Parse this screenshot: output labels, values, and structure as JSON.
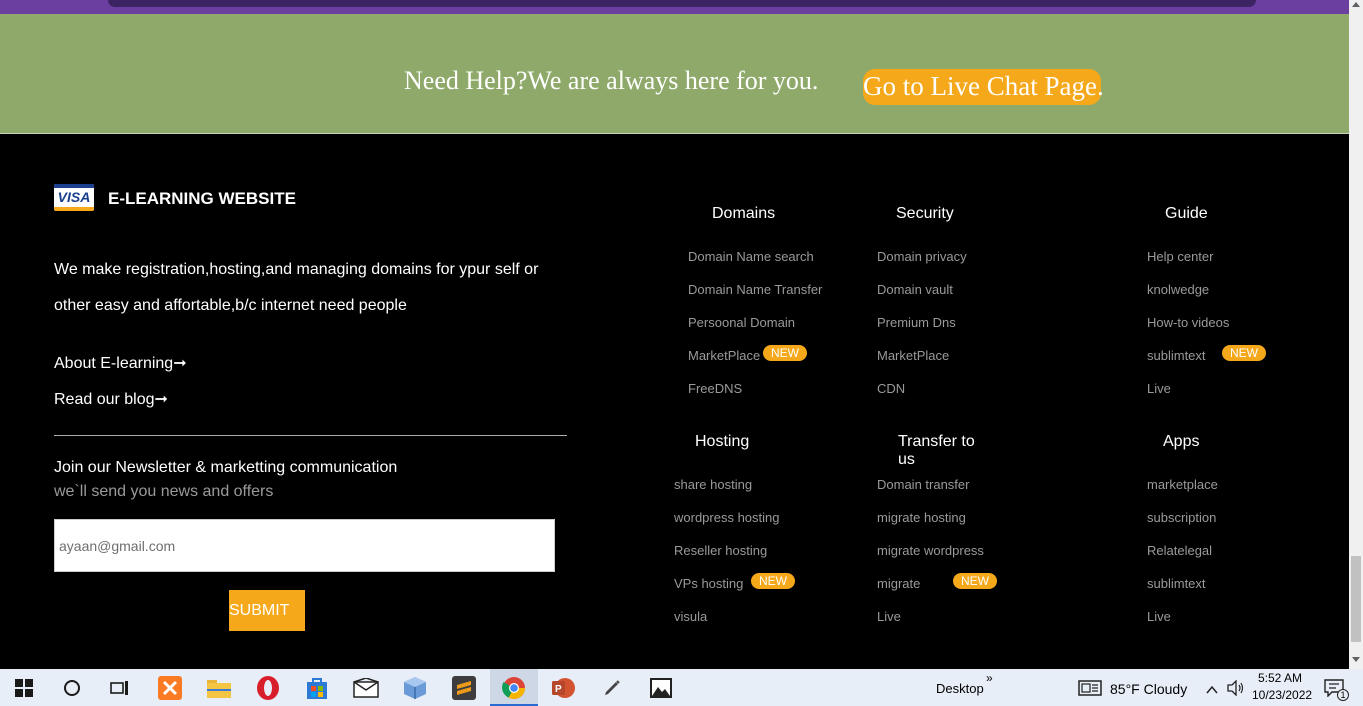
{
  "help_banner": {
    "text": "Need Help?We are always here for you.",
    "button_label": "Go to Live Chat Page."
  },
  "footer": {
    "logo_text": "VISA",
    "brand": "E-LEARNING WEBSITE",
    "description": "We make registration,hosting,and managing domains for ypur self or other easy and affortable,b/c internet need people",
    "link_about": "About E-learning➞",
    "link_blog": "Read our blog➞",
    "newsletter_title": "Join our Newsletter & marketting communication",
    "newsletter_sub": "we`ll send you news and offers",
    "email_placeholder": "ayaan@gmail.com",
    "submit_label": "SUBMIT",
    "badge_label": "NEW",
    "columns": {
      "domains": {
        "title": "Domains",
        "links": [
          "Domain Name search",
          "Domain Name Transfer",
          "Persoonal Domain",
          "MarketPlace",
          "FreeDNS"
        ]
      },
      "security": {
        "title": "Security",
        "links": [
          "Domain privacy",
          "Domain vault",
          "Premium Dns",
          "MarketPlace",
          "CDN"
        ]
      },
      "guide": {
        "title": "Guide",
        "links": [
          "Help center",
          "knolwedge",
          "How-to videos",
          "sublimtext",
          "Live"
        ]
      },
      "hosting": {
        "title": "Hosting",
        "links": [
          "share hosting",
          "wordpress hosting",
          "Reseller hosting",
          "VPs hosting",
          "visula"
        ]
      },
      "transfer": {
        "title": "Transfer to us",
        "links": [
          "Domain transfer",
          "migrate hosting",
          "migrate wordpress",
          "migrate",
          "Live"
        ]
      },
      "apps": {
        "title": "Apps",
        "links": [
          "marketplace",
          "subscription",
          "Relatelegal",
          "sublimtext",
          "Live"
        ]
      }
    }
  },
  "taskbar": {
    "desktop_label": "Desktop",
    "chevron": "»",
    "weather": "85°F  Cloudy",
    "time": "5:52 AM",
    "date": "10/23/2022",
    "notification_count": "1",
    "icons": [
      "start-icon",
      "search-icon",
      "task-view-icon",
      "xampp-icon",
      "file-explorer-icon",
      "opera-icon",
      "store-icon",
      "mail-icon",
      "box-icon",
      "sublime-icon",
      "chrome-icon",
      "powerpoint-icon",
      "pen-icon",
      "photos-icon"
    ]
  },
  "colors": {
    "accent": "#f5a81a",
    "banner": "#8fa96a",
    "footer_bg": "#000000",
    "link_gray": "#9a9a9a"
  }
}
